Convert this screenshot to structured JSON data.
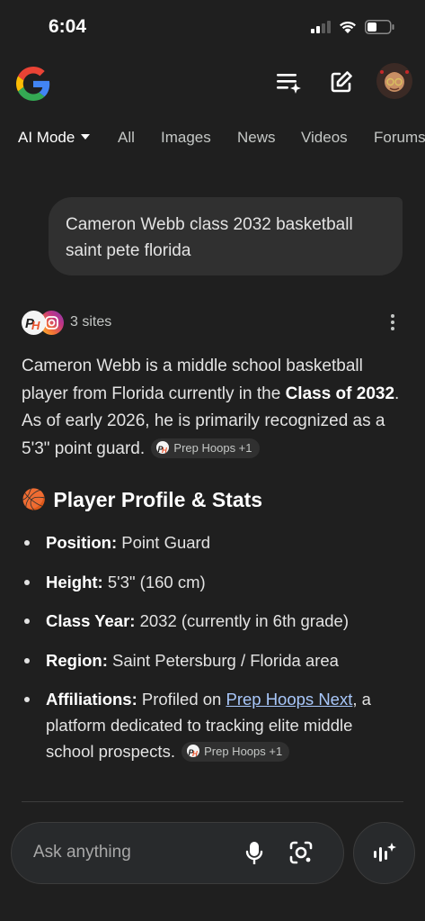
{
  "status_bar": {
    "time": "6:04"
  },
  "tabs": [
    "AI Mode",
    "All",
    "Images",
    "News",
    "Videos",
    "Forums"
  ],
  "query": "Cameron Webb class 2032 basketball saint pete florida",
  "sources": {
    "label": "3 sites"
  },
  "answer": {
    "part1": "Cameron Webb is a middle school basketball player from Florida currently in the ",
    "bold1": "Class of 2032",
    "part2": ". As of early 2026, he is primarily recognized as a 5'3\" point guard.",
    "chip": "Prep Hoops +1"
  },
  "section": {
    "emoji": "🏀",
    "title": "Player Profile & Stats"
  },
  "profile": [
    {
      "label": "Position:",
      "value": " Point Guard"
    },
    {
      "label": "Height:",
      "value": " 5'3\" (160 cm)"
    },
    {
      "label": "Class Year:",
      "value": " 2032 (currently in 6th grade)"
    },
    {
      "label": "Region:",
      "value": " Saint Petersburg / Florida area"
    },
    {
      "label": "Affiliations:",
      "value_pre": " Profiled on ",
      "link": "Prep Hoops Next",
      "value_post": ", a platform dedicated to tracking elite middle school prospects.",
      "chip": "Prep Hoops +1"
    }
  ],
  "input": {
    "placeholder": "Ask anything"
  },
  "colors": {
    "background": "#1f1f1f",
    "surface": "#303030",
    "link": "#a8c7fa"
  }
}
